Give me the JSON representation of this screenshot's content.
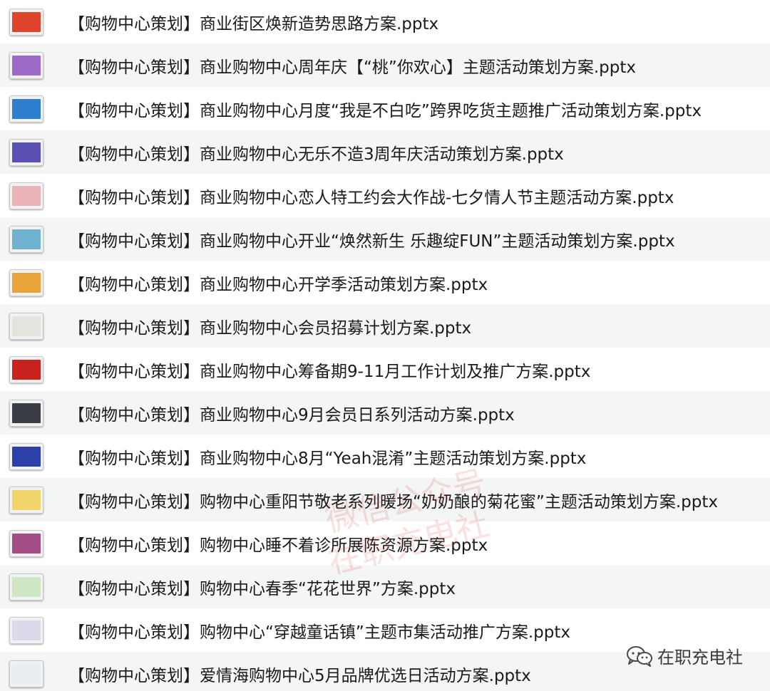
{
  "files": [
    {
      "name": "【购物中心策划】商业街区焕新造势思路方案.pptx",
      "thumb_color": "#e0452c"
    },
    {
      "name": "【购物中心策划】商业购物中心周年庆【“桃”你欢心】主题活动策划方案.pptx",
      "thumb_color": "#9c6bc7"
    },
    {
      "name": "【购物中心策划】商业购物中心月度“我是不白吃”跨界吃货主题推广活动策划方案.pptx",
      "thumb_color": "#2e7fd0"
    },
    {
      "name": "【购物中心策划】商业购物中心无乐不造3周年庆活动策划方案.pptx",
      "thumb_color": "#5a4fb3"
    },
    {
      "name": "【购物中心策划】商业购物中心恋人特工约会大作战-七夕情人节主题活动方案.pptx",
      "thumb_color": "#e9b3b7"
    },
    {
      "name": "【购物中心策划】商业购物中心开业“焕然新生 乐趣绽FUN”主题活动策划方案.pptx",
      "thumb_color": "#6fb2cf"
    },
    {
      "name": "【购物中心策划】商业购物中心开学季活动策划方案.pptx",
      "thumb_color": "#e8a33a"
    },
    {
      "name": "【购物中心策划】商业购物中心会员招募计划方案.pptx",
      "thumb_color": "#e4e4de"
    },
    {
      "name": "【购物中心策划】商业购物中心筹备期9-11月工作计划及推广方案.pptx",
      "thumb_color": "#c8231f"
    },
    {
      "name": "【购物中心策划】商业购物中心9月会员日系列活动方案.pptx",
      "thumb_color": "#3a3d44"
    },
    {
      "name": "【购物中心策划】商业购物中心8月“Yeah混淆”主题活动策划方案.pptx",
      "thumb_color": "#2d3fa8"
    },
    {
      "name": "【购物中心策划】购物中心重阳节敬老系列暖场“奶奶酿的菊花蜜”主题活动策划方案.pptx",
      "thumb_color": "#f1d46a"
    },
    {
      "name": "【购物中心策划】购物中心睡不着诊所展陈资源方案.pptx",
      "thumb_color": "#a34c86"
    },
    {
      "name": "【购物中心策划】购物中心春季“花花世界”方案.pptx",
      "thumb_color": "#cfe6c5"
    },
    {
      "name": "【购物中心策划】购物中心“穿越童话镇”主题市集活动推广方案.pptx",
      "thumb_color": "#ddd9ea"
    },
    {
      "name": "【购物中心策划】爱情海购物中心5月品牌优选日活动方案.pptx",
      "thumb_color": "#e9eef2"
    }
  ],
  "watermark": {
    "line1": "微信公众号",
    "line2": "在职充电社"
  },
  "brand": {
    "label": "在职充电社",
    "icon": "wechat-icon"
  }
}
